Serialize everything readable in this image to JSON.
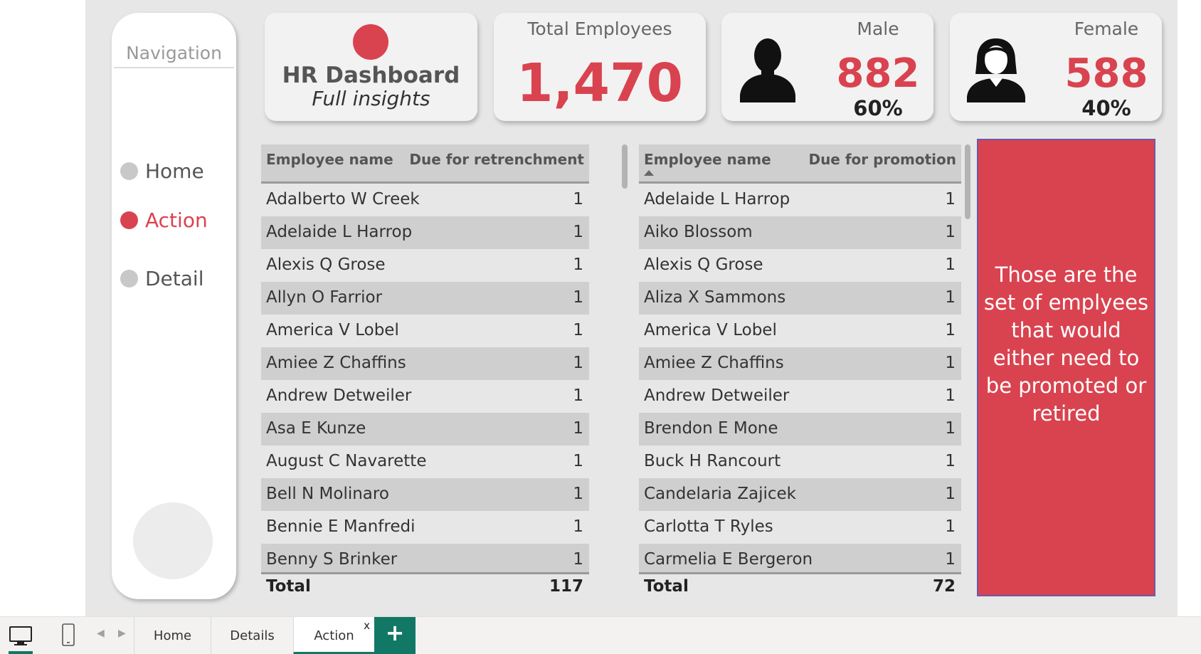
{
  "navigation": {
    "title": "Navigation",
    "items": [
      {
        "label": "Home",
        "active": false
      },
      {
        "label": "Action",
        "active": true
      },
      {
        "label": "Detail",
        "active": false
      }
    ]
  },
  "cards": {
    "hr": {
      "title": "HR Dashboard",
      "subtitle": "Full insights"
    },
    "total": {
      "label": "Total Employees",
      "value": "1,470"
    },
    "male": {
      "label": "Male",
      "value": "882",
      "percent": "60%",
      "icon": "male-person-icon"
    },
    "female": {
      "label": "Female",
      "value": "588",
      "percent": "40%",
      "icon": "female-person-icon"
    }
  },
  "retrenchment_table": {
    "columns": [
      "Employee name",
      "Due for retrenchment"
    ],
    "rows": [
      [
        "Adalberto W Creek",
        "1"
      ],
      [
        "Adelaide L Harrop",
        "1"
      ],
      [
        "Alexis Q Grose",
        "1"
      ],
      [
        "Allyn O Farrior",
        "1"
      ],
      [
        "America V Lobel",
        "1"
      ],
      [
        "Amiee Z Chaffins",
        "1"
      ],
      [
        "Andrew Detweiler",
        "1"
      ],
      [
        "Asa E Kunze",
        "1"
      ],
      [
        "August C Navarette",
        "1"
      ],
      [
        "Bell N Molinaro",
        "1"
      ],
      [
        "Bennie E Manfredi",
        "1"
      ],
      [
        "Benny S Brinker",
        "1"
      ]
    ],
    "total_label": "Total",
    "total_value": "117"
  },
  "promotion_table": {
    "columns": [
      "Employee name",
      "Due for promotion"
    ],
    "sorted_column": "Employee name",
    "rows": [
      [
        "Adelaide L Harrop",
        "1"
      ],
      [
        "Aiko Blossom",
        "1"
      ],
      [
        "Alexis Q Grose",
        "1"
      ],
      [
        "Aliza X Sammons",
        "1"
      ],
      [
        "America V Lobel",
        "1"
      ],
      [
        "Amiee Z Chaffins",
        "1"
      ],
      [
        "Andrew Detweiler",
        "1"
      ],
      [
        "Brendon E Mone",
        "1"
      ],
      [
        "Buck H Rancourt",
        "1"
      ],
      [
        "Candelaria Zajicek",
        "1"
      ],
      [
        "Carlotta T Ryles",
        "1"
      ],
      [
        "Carmelia E Bergeron",
        "1"
      ]
    ],
    "total_label": "Total",
    "total_value": "72"
  },
  "note": {
    "text": "Those are the set of emplyees that would either need to be promoted or retired"
  },
  "tabbar": {
    "tabs": [
      {
        "label": "Home",
        "active": false
      },
      {
        "label": "Details",
        "active": false
      },
      {
        "label": "Action",
        "active": true
      }
    ],
    "close_glyph": "x",
    "add_glyph": "+"
  },
  "colors": {
    "accent": "#d9434f",
    "canvas": "#e7e7e7",
    "tab_accent": "#117865"
  }
}
